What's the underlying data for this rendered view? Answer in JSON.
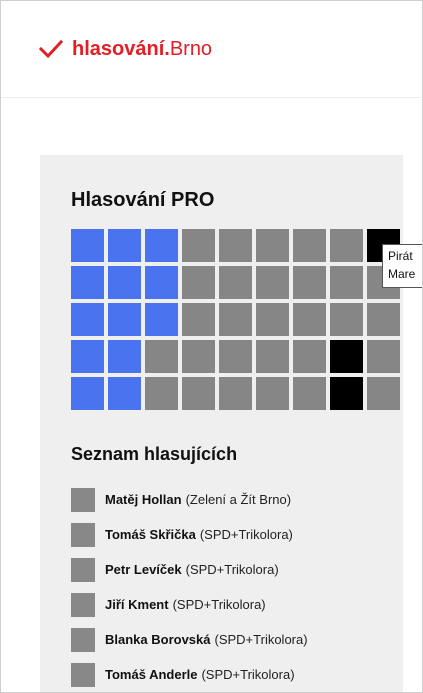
{
  "header": {
    "logo_strong": "hlasování.",
    "logo_light": "Brno"
  },
  "vote_panel": {
    "title": "Hlasování PRO",
    "seat_grid": {
      "rows": [
        [
          "blue",
          "blue",
          "blue",
          "gray",
          "gray",
          "gray",
          "gray",
          "gray",
          "black"
        ],
        [
          "blue",
          "blue",
          "blue",
          "gray",
          "gray",
          "gray",
          "gray",
          "gray",
          "gray"
        ],
        [
          "blue",
          "blue",
          "blue",
          "gray",
          "gray",
          "gray",
          "gray",
          "gray",
          "gray"
        ],
        [
          "blue",
          "blue",
          "gray",
          "gray",
          "gray",
          "gray",
          "gray",
          "black",
          "gray"
        ],
        [
          "blue",
          "blue",
          "gray",
          "gray",
          "gray",
          "gray",
          "gray",
          "black",
          "gray"
        ]
      ],
      "colors": {
        "blue": "#4a73f0",
        "gray": "#868686",
        "black": "#000000"
      }
    },
    "tooltip": {
      "line1": "Pirát",
      "line2": "Mare"
    }
  },
  "voter_list": {
    "title": "Seznam hlasujících",
    "items": [
      {
        "name": "Matěj Hollan",
        "party": "(Zelení a Žít Brno)"
      },
      {
        "name": "Tomáš Skřička",
        "party": "(SPD+Trikolora)"
      },
      {
        "name": "Petr Levíček",
        "party": "(SPD+Trikolora)"
      },
      {
        "name": "Jiří Kment",
        "party": "(SPD+Trikolora)"
      },
      {
        "name": "Blanka Borovská",
        "party": "(SPD+Trikolora)"
      },
      {
        "name": "Tomáš Anderle",
        "party": "(SPD+Trikolora)"
      }
    ]
  },
  "colors": {
    "brand_red": "#e31e24",
    "panel_bg": "#efefef",
    "swatch_gray": "#888888"
  }
}
